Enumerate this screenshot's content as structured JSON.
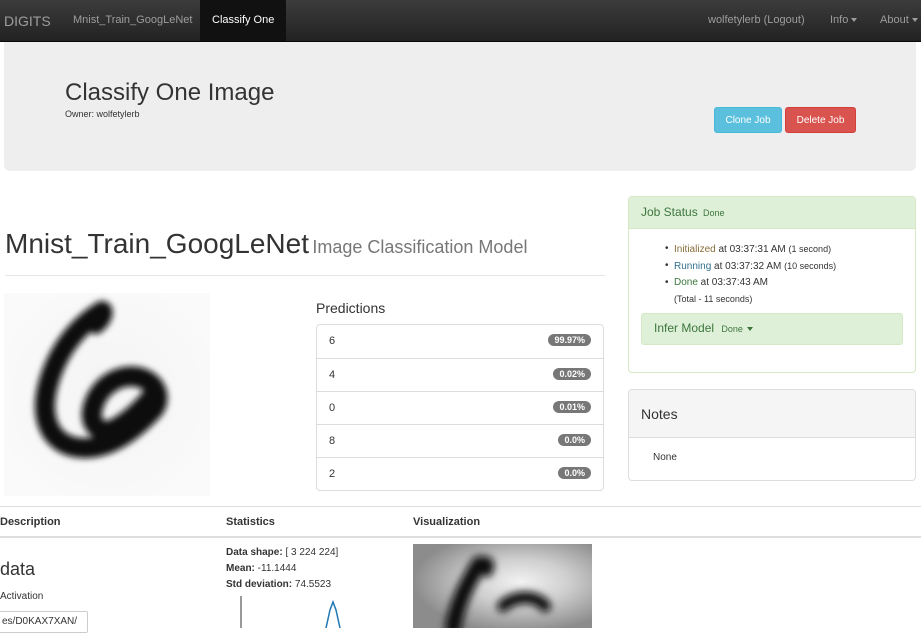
{
  "navbar": {
    "brand": "DIGITS",
    "links": [
      "Mnist_Train_GoogLeNet",
      "Classify One"
    ],
    "user": "wolfetylerb (Logout)",
    "info": "Info",
    "about": "About"
  },
  "jumbotron": {
    "title": "Classify One Image",
    "owner": "Owner: wolfetylerb",
    "clone_label": "Clone Job",
    "delete_label": "Delete Job"
  },
  "model": {
    "name": "Mnist_Train_GoogLeNet",
    "type": "Image Classification Model"
  },
  "predictions": {
    "title": "Predictions",
    "items": [
      {
        "label": "6",
        "value": "99.97%"
      },
      {
        "label": "4",
        "value": "0.02%"
      },
      {
        "label": "0",
        "value": "0.01%"
      },
      {
        "label": "8",
        "value": "0.0%"
      },
      {
        "label": "2",
        "value": "0.0%"
      }
    ]
  },
  "job_status": {
    "title": "Job Status",
    "state": "Done",
    "events": [
      {
        "status": "Initialized",
        "time": " at 03:37:31 AM",
        "duration": "(1 second)"
      },
      {
        "status": "Running",
        "time": " at 03:37:32 AM",
        "duration": "(10 seconds)"
      },
      {
        "status": "Done",
        "time": " at 03:37:43 AM",
        "duration": ""
      }
    ],
    "total": "(Total - 11 seconds)",
    "infer_label": "Infer Model",
    "infer_state": "Done"
  },
  "notes": {
    "title": "Notes",
    "body": "None"
  },
  "table": {
    "headers": [
      "Description",
      "Statistics",
      "Visualization"
    ],
    "layer_name": "data",
    "layer_type": "Activation",
    "path": "es/D0KAX7XAN/",
    "stats": {
      "shape_label": "Data shape:",
      "shape_value": " [ 3 224 224]",
      "mean_label": "Mean:",
      "mean_value": " -11.1444",
      "std_label": "Std deviation:",
      "std_value": " 74.5523"
    }
  },
  "colors": {
    "navbar": "#222222",
    "info_button": "#5bc0de",
    "danger_button": "#d9534f",
    "success_panel": "#dff0d8",
    "badge": "#777777"
  }
}
